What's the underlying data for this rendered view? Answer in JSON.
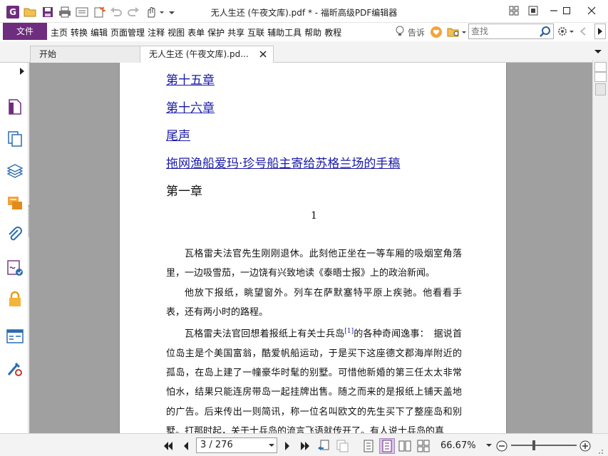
{
  "titlebar": {
    "app_logo": "G",
    "title": "无人生还 (午夜文库).pdf * - 福昕高级PDF编辑器"
  },
  "menubar": {
    "file_label": "文件",
    "items": [
      "主页",
      "转换",
      "编辑",
      "页面管理",
      "注释",
      "视图",
      "表单",
      "保护",
      "共享",
      "互联",
      "辅助工具",
      "帮助",
      "教程"
    ],
    "tell_me": "告诉",
    "search_placeholder": "查找"
  },
  "tabs": [
    {
      "label": "开始",
      "active": false
    },
    {
      "label": "无人生还 (午夜文库).pd...",
      "active": true
    }
  ],
  "document": {
    "toc_links": [
      "第十五章",
      "第十六章",
      "尾声",
      "拖网渔船爱玛·珍号船主寄给苏格兰场的手稿"
    ],
    "chapter_heading": "第一章",
    "section_number": "1",
    "paragraphs": [
      "瓦格雷夫法官先生刚刚退休。此刻他正坐在一等车厢的吸烟室角落里，一边吸雪茄，一边饶有兴致地读《泰晤士报》上的政治新闻。",
      "他放下报纸，眺望窗外。列车在萨默塞特平原上疾驰。他看看手表，还有两小时的路程。",
      "瓦格雷夫法官回想着报纸上有关士兵岛",
      "的各种奇闻逸事：　据说首位岛主是个美国富翁，酷爱帆船运动，于是买下这座德文郡海岸附近的孤岛，在岛上建了一幢豪华时髦的别墅。可惜他新婚的第三任太太非常怕水，结果只能连房带岛一起挂牌出售。随之而来的是报纸上铺天盖地的广告。后来传出一则简讯，称一位名叫欧文的先生买下了整座岛和别墅。打那时起，关于士兵岛的流言飞语就传开了。有人说士兵岛的真"
    ],
    "footnote_marker": "[1]"
  },
  "statusbar": {
    "page_value": "3 / 276",
    "zoom_value": "66.67%"
  },
  "colors": {
    "accent": "#6e2d7e",
    "link": "#1a1aa8",
    "doc_background": "#a0a0a0"
  }
}
